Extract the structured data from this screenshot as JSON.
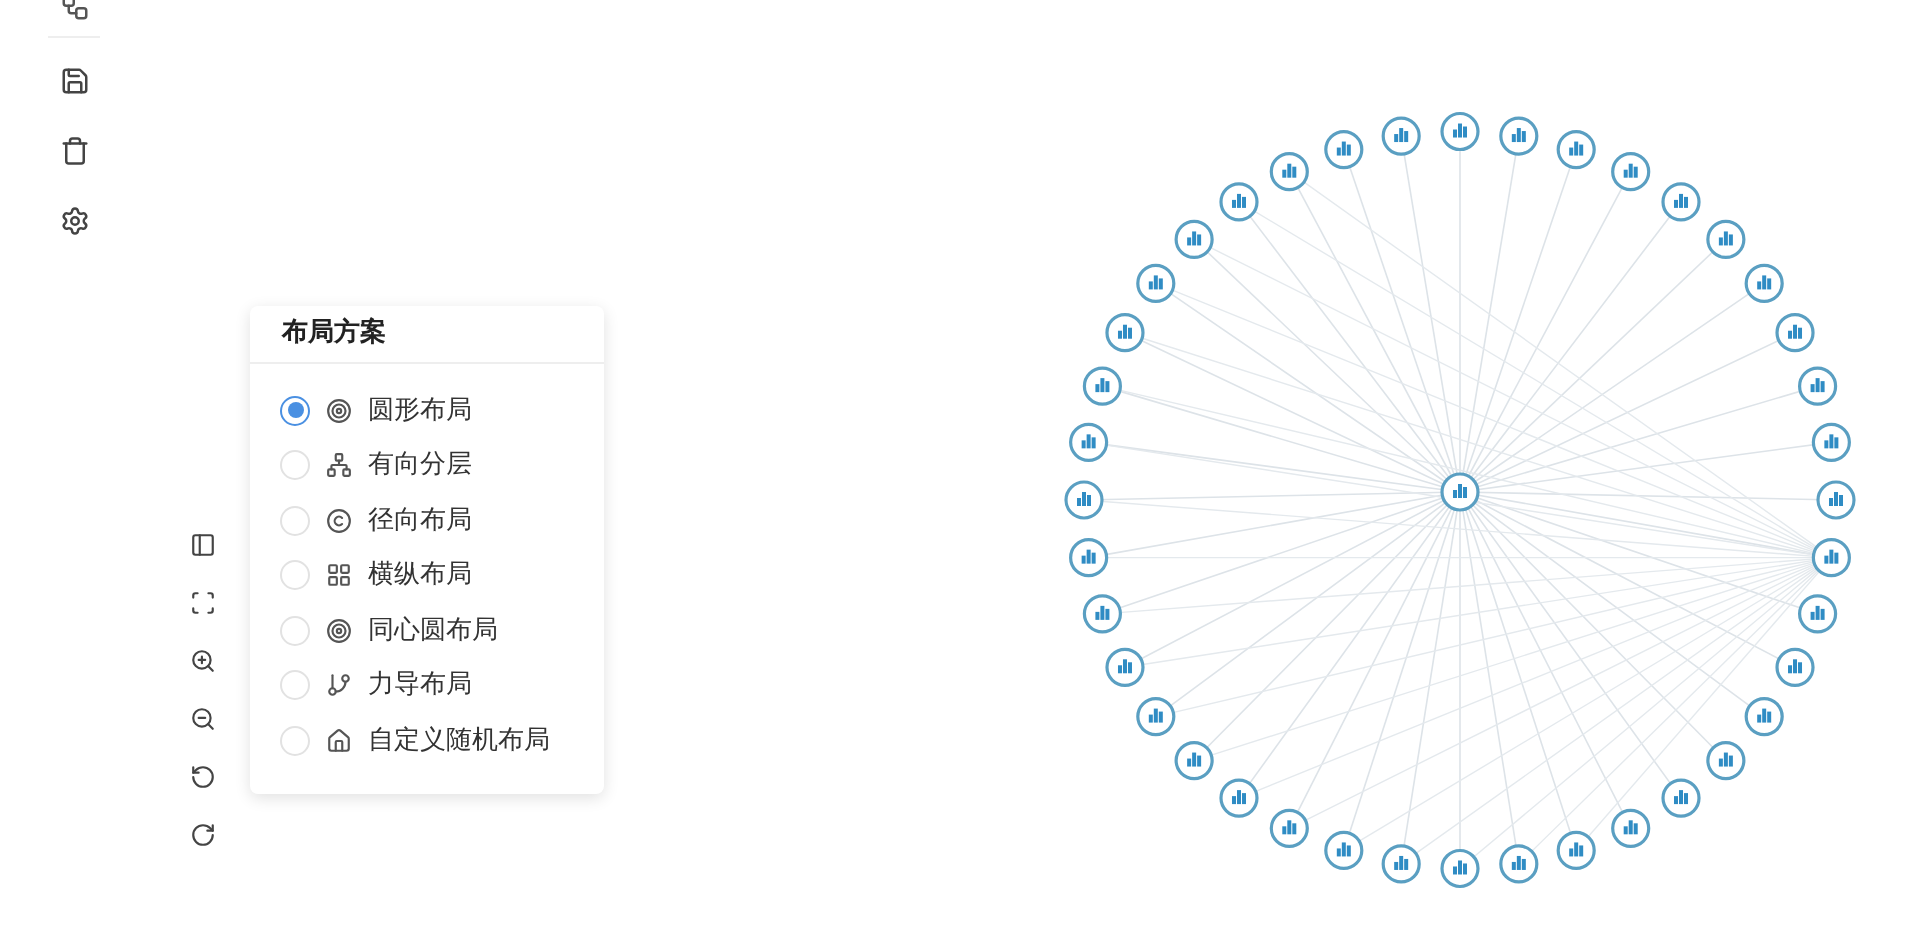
{
  "layout_panel": {
    "title": "布局方案",
    "options": [
      {
        "label": "圆形布局",
        "selected": true
      },
      {
        "label": "有向分层",
        "selected": false
      },
      {
        "label": "径向布局",
        "selected": false
      },
      {
        "label": "横纵布局",
        "selected": false
      },
      {
        "label": "同心圆布局",
        "selected": false
      },
      {
        "label": "力导布局",
        "selected": false
      },
      {
        "label": "自定义随机布局",
        "selected": false
      }
    ]
  }
}
